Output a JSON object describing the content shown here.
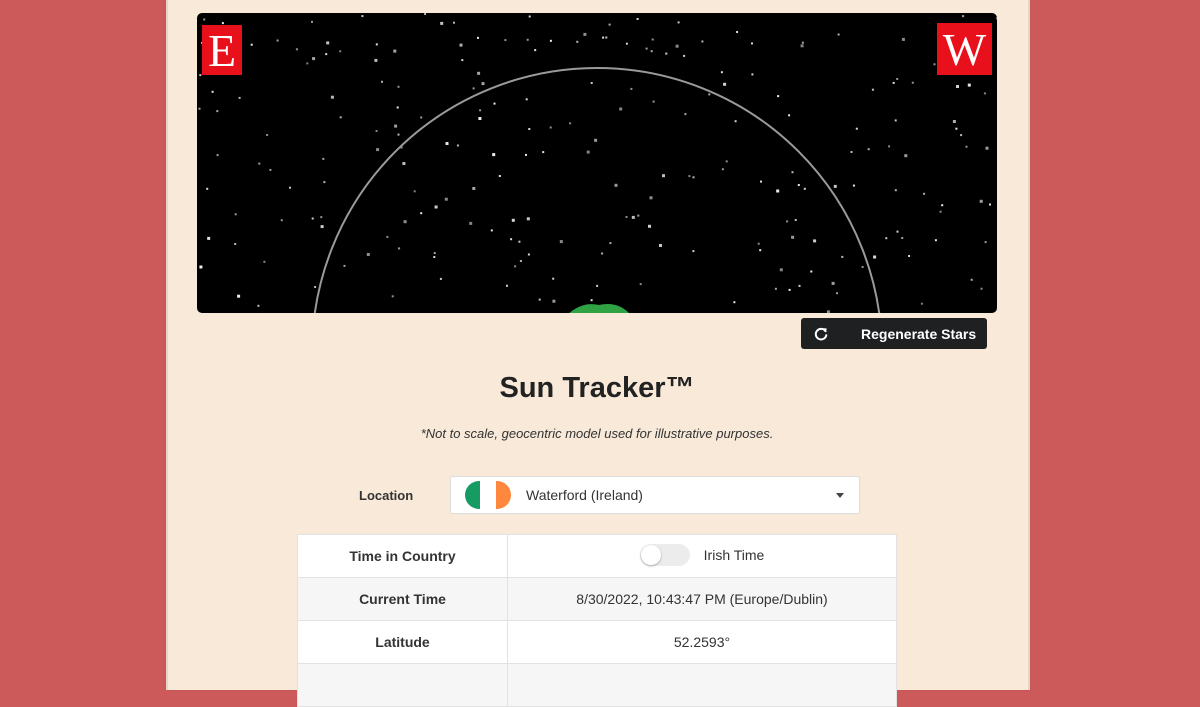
{
  "logos": {
    "left_letter": "E",
    "right_letter": "W",
    "color": "#e8101a"
  },
  "regenerate_button": {
    "label": "Regenerate Stars",
    "icon": "refresh-icon"
  },
  "title": "Sun Tracker™",
  "subtitle": "*Not to scale, geocentric model used for illustrative purposes.",
  "location": {
    "label": "Location",
    "selected": "Waterford (Ireland)",
    "flag_colors": [
      "#169b62",
      "#ffffff",
      "#ff883e"
    ]
  },
  "info_table": {
    "time_in_country": {
      "label": "Time in Country",
      "toggle_label": "Irish Time",
      "toggle_on": false
    },
    "current_time": {
      "label": "Current Time",
      "value": "8/30/2022, 10:43:47 PM (Europe/Dublin)"
    },
    "latitude": {
      "label": "Latitude",
      "value": "52.2593°"
    }
  },
  "colors": {
    "background": "#cd5a5a",
    "paper": "#f8e9d8",
    "button": "#1f2022"
  }
}
